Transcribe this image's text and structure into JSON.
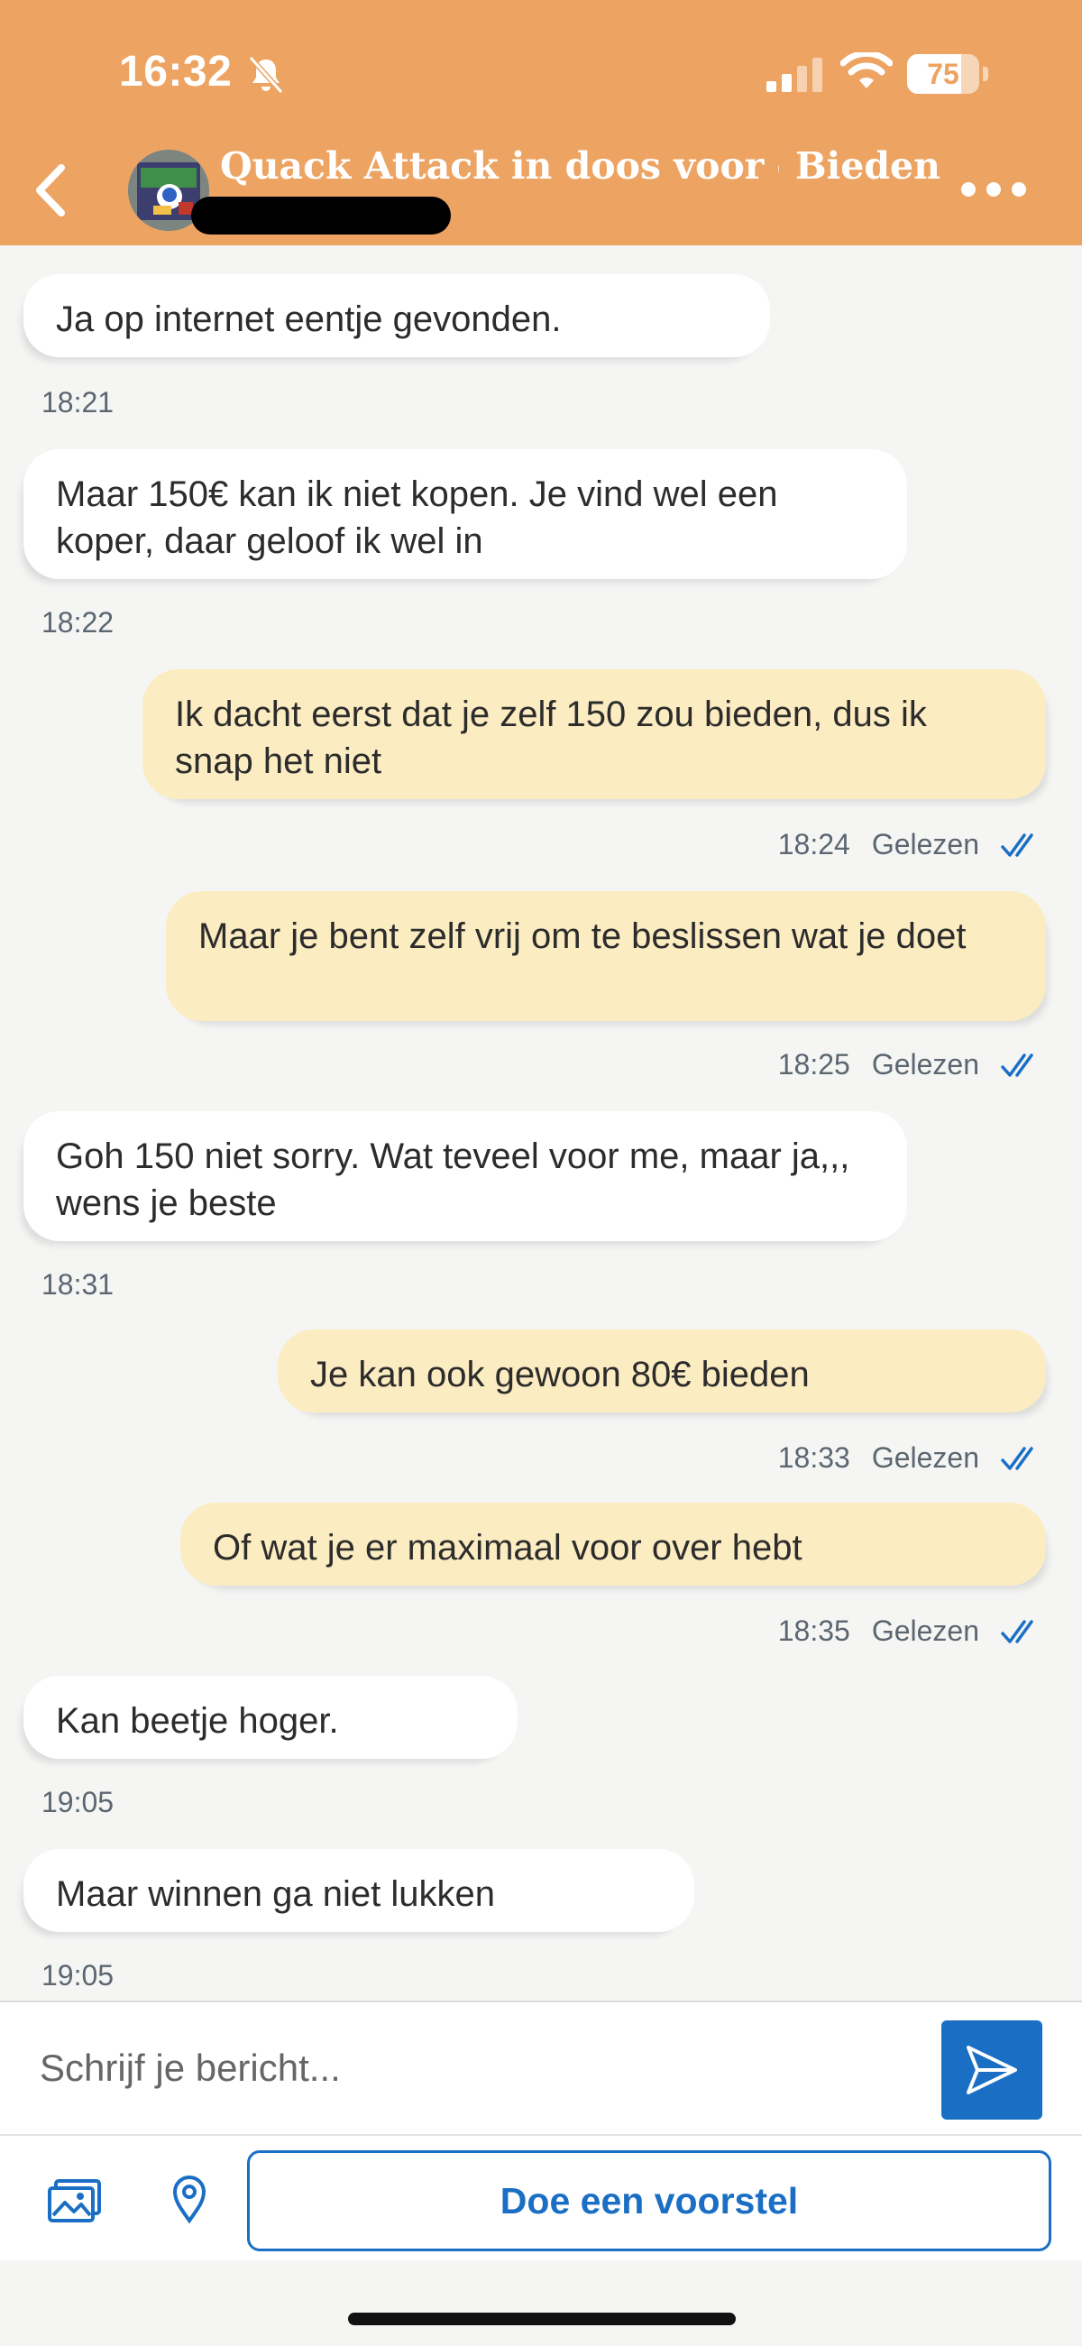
{
  "status_bar": {
    "time": "16:32",
    "battery_level": "75",
    "battery_fraction": 0.75,
    "icons": [
      "bell-slash-icon",
      "cellular-signal-icon",
      "wifi-icon",
      "battery-icon"
    ]
  },
  "header": {
    "title": "Quack Attack in doos voor de...",
    "bid_label": "Bieden",
    "back_icon": "chevron-left-icon",
    "more_icon": "ellipsis-icon",
    "background_color": "#eda463"
  },
  "messages": [
    {
      "direction": "incoming",
      "text": "Ja op internet eentje gevonden.",
      "time": "18:21"
    },
    {
      "direction": "incoming",
      "text": "Maar 150€ kan ik niet kopen. Je vind wel een koper, daar geloof ik wel in",
      "time": "18:22"
    },
    {
      "direction": "outgoing",
      "text": "Ik dacht eerst dat je zelf 150 zou bieden, dus ik snap het niet",
      "time": "18:24",
      "status": "Gelezen"
    },
    {
      "direction": "outgoing",
      "text": "Maar je bent zelf vrij om te beslissen wat je doet",
      "time": "18:25",
      "status": "Gelezen"
    },
    {
      "direction": "incoming",
      "text": "Goh 150 niet sorry. Wat teveel voor me, maar ja,,, wens je beste",
      "time": "18:31"
    },
    {
      "direction": "outgoing",
      "text": "Je kan ook gewoon 80€ bieden",
      "time": "18:33",
      "status": "Gelezen"
    },
    {
      "direction": "outgoing",
      "text": "Of wat je er maximaal voor over hebt",
      "time": "18:35",
      "status": "Gelezen"
    },
    {
      "direction": "incoming",
      "text": "Kan beetje hoger.",
      "time": "19:05"
    },
    {
      "direction": "incoming",
      "text": "Maar winnen ga niet lukken",
      "time": "19:05"
    }
  ],
  "composer": {
    "placeholder": "Schrijf je bericht...",
    "send_icon": "send-icon"
  },
  "actions": {
    "gallery_icon": "image-gallery-icon",
    "location_icon": "location-pin-icon",
    "proposal_label": "Doe een voorstel"
  },
  "colors": {
    "incoming_bubble": "#ffffff",
    "outgoing_bubble": "#fcecc1",
    "accent_blue": "#1a6fc4",
    "chat_background": "#f5f5f4"
  }
}
